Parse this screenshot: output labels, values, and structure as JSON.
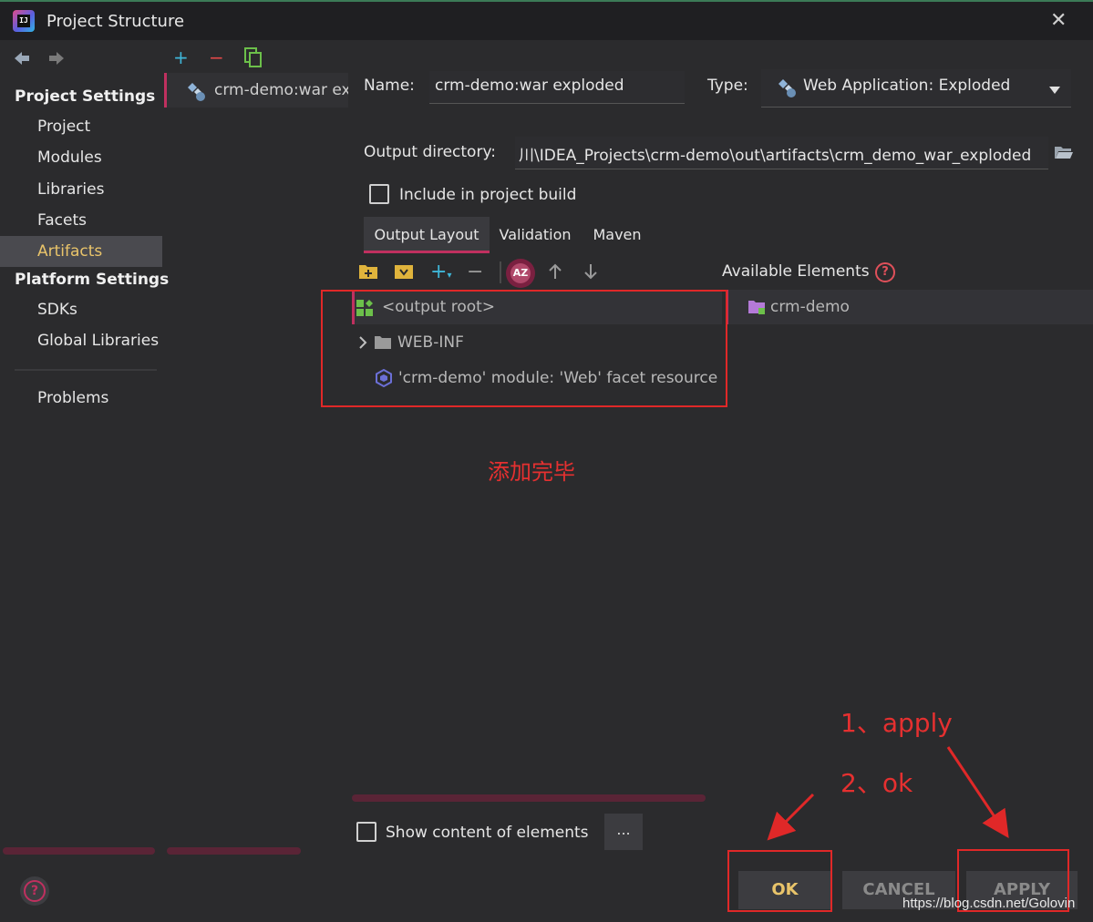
{
  "window": {
    "title": "Project Structure"
  },
  "sidebar": {
    "project_settings_header": "Project Settings",
    "platform_settings_header": "Platform Settings",
    "items": [
      {
        "label": "Project"
      },
      {
        "label": "Modules"
      },
      {
        "label": "Libraries"
      },
      {
        "label": "Facets"
      },
      {
        "label": "Artifacts",
        "selected": true
      },
      {
        "label": "SDKs"
      },
      {
        "label": "Global Libraries"
      },
      {
        "label": "Problems"
      }
    ]
  },
  "artifacts_list": {
    "items": [
      {
        "label": "crm-demo:war ex"
      }
    ]
  },
  "form": {
    "name_label": "Name:",
    "name_value": "crm-demo:war exploded",
    "type_label": "Type:",
    "type_value": "Web Application: Exploded",
    "output_dir_label": "Output directory:",
    "output_dir_value": "川\\IDEA_Projects\\crm-demo\\out\\artifacts\\crm_demo_war_exploded",
    "include_label": "Include in project build",
    "include_checked": false
  },
  "tabs": [
    {
      "label": "Output Layout",
      "active": true
    },
    {
      "label": "Validation"
    },
    {
      "label": "Maven"
    }
  ],
  "layout_tree": [
    {
      "label": "<output root>"
    },
    {
      "label": "WEB-INF"
    },
    {
      "label": "'crm-demo' module: 'Web' facet resource"
    }
  ],
  "available": {
    "label": "Available Elements",
    "items": [
      {
        "label": "crm-demo"
      }
    ]
  },
  "footer": {
    "show_content_label": "Show content of elements",
    "ellipsis_label": "...",
    "ok_label": "OK",
    "cancel_label": "CANCEL",
    "apply_label": "APPLY"
  },
  "annotations": {
    "added_text": "添加完毕",
    "step1": "1、apply",
    "step2": "2、ok"
  },
  "watermark": "https://blog.csdn.net/Golovin",
  "colors": {
    "accent": "#c0305f",
    "selected_text": "#e9c46a",
    "annotation_red": "#e02828"
  }
}
